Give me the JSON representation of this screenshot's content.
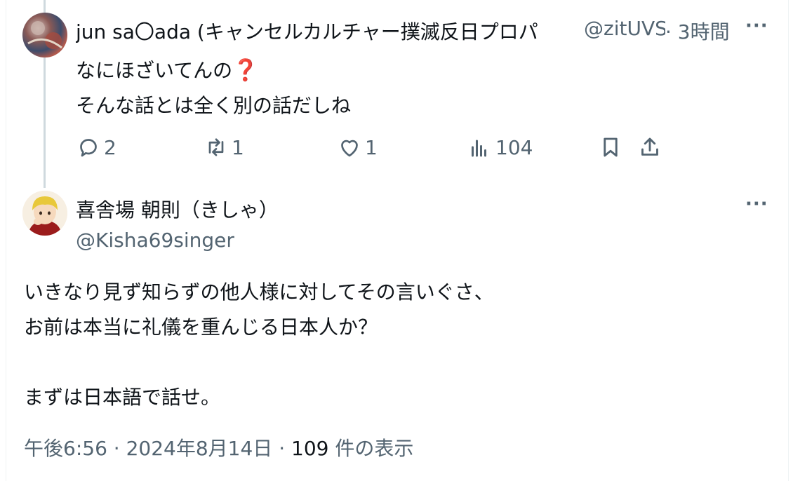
{
  "tweet1": {
    "author_name": "jun sa〇ada (キャンセルカルチャー撲滅反日プロパ",
    "handle": "@zitUVS",
    "time": "· 3時間",
    "more": "···",
    "lines": [
      "なにほざいてんの",
      "そんな話とは全く別の話だしね"
    ],
    "emoji": "❓",
    "stats": {
      "replies": "2",
      "retweets": "1",
      "likes": "1",
      "views": "104"
    }
  },
  "tweet2": {
    "author_name": "喜舎場 朝則（きしゃ）",
    "handle": "@Kisha69singer",
    "more": "···",
    "lines": [
      "いきなり見ず知らずの他人様に対してその言いぐさ、",
      "お前は本当に礼儀を重んじる日本人か？",
      "",
      "まずは日本語で話せ。"
    ],
    "time": "午後6:56",
    "date": "2024年8月14日",
    "views_count": "109",
    "views_label": "件の表示",
    "sep": "·"
  },
  "icons": [
    "reply-icon",
    "retweet-icon",
    "like-icon",
    "views-icon",
    "bookmark-icon",
    "share-icon",
    "more-icon"
  ]
}
